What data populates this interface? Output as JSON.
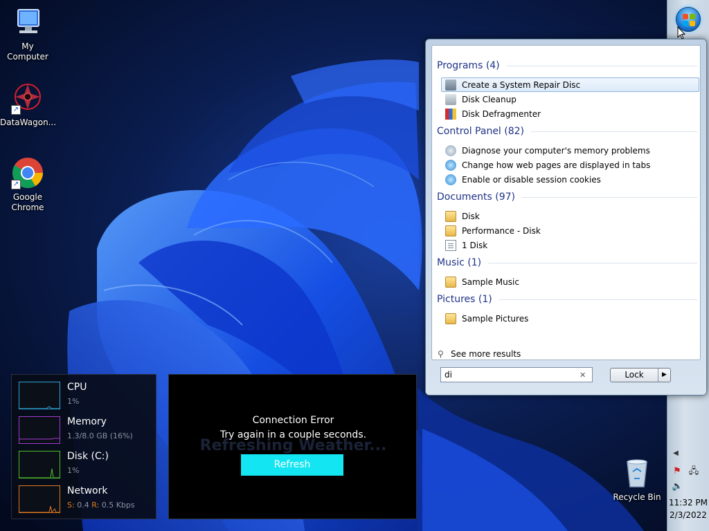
{
  "desktop": {
    "icons": [
      {
        "label": "My Computer"
      },
      {
        "label": "DataWagon..."
      },
      {
        "label": "Google Chrome"
      },
      {
        "label": "Recycle Bin"
      }
    ]
  },
  "start_menu": {
    "groups": [
      {
        "title": "Programs (4)",
        "items": [
          {
            "label": "Create a System Repair Disc",
            "icon": "repair-disc-icon",
            "selected": true
          },
          {
            "label": "Disk Cleanup",
            "icon": "disk-cleanup-icon"
          },
          {
            "label": "Disk Defragmenter",
            "icon": "defragmenter-icon"
          }
        ]
      },
      {
        "title": "Control Panel (82)",
        "items": [
          {
            "label": "Diagnose your computer's memory problems",
            "icon": "control-panel-icon"
          },
          {
            "label": "Change how web pages are displayed in tabs",
            "icon": "internet-options-icon"
          },
          {
            "label": "Enable or disable session cookies",
            "icon": "internet-options-icon"
          }
        ]
      },
      {
        "title": "Documents (97)",
        "items": [
          {
            "label": "Disk",
            "icon": "folder-icon"
          },
          {
            "label": "Performance - Disk",
            "icon": "folder-icon"
          },
          {
            "label": "1 Disk",
            "icon": "document-icon"
          }
        ]
      },
      {
        "title": "Music (1)",
        "items": [
          {
            "label": "Sample Music",
            "icon": "folder-icon"
          }
        ]
      },
      {
        "title": "Pictures (1)",
        "items": [
          {
            "label": "Sample Pictures",
            "icon": "folder-icon"
          }
        ]
      }
    ],
    "see_more": "See more results",
    "search_value": "di",
    "lock_label": "Lock"
  },
  "perf_gadget": {
    "meters": [
      {
        "name": "CPU",
        "value": "1%",
        "color": "#2fa6d8"
      },
      {
        "name": "Memory",
        "value": "1.3/8.0 GB (16%)",
        "color": "#a33bd1"
      },
      {
        "name": "Disk (C:)",
        "value": "1%",
        "color": "#4fbf2a"
      },
      {
        "name": "Network",
        "value_s_label": "S:",
        "value_s": "0.4",
        "value_r_label": "R:",
        "value_r": "0.5 Kbps",
        "color": "#e07a1e"
      }
    ]
  },
  "weather_gadget": {
    "background_text": "Refreshing Weather...",
    "error_title": "Connection Error",
    "error_message": "Try again in a couple seconds.",
    "refresh_label": "Refresh",
    "accent": "#13e6f2"
  },
  "taskbar": {
    "time": "11:32 PM",
    "date": "2/3/2022",
    "tray_icons": [
      "show-hidden-icon",
      "action-center-flag-icon",
      "network-icon",
      "volume-icon"
    ]
  }
}
